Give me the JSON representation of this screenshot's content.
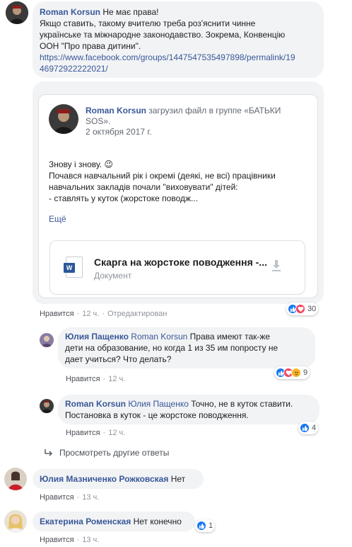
{
  "comment1": {
    "author": "Roman Korsun",
    "text_lines": [
      "Не має права!",
      "Якщо ставить, такому вчителю треба роз'яснити чинне",
      "українське та міжнародне законодавство. Зокрема, Конвенцію",
      "ООН \"Про права дитини\"."
    ],
    "link_lines": [
      "https://www.facebook.com/groups/1447547535497898/permalink/19",
      "46972922222021/"
    ],
    "shared": {
      "author": "Roman Korsun",
      "action": "загрузил файл в группе «БАТЬКИ",
      "group_cont": "SOS».",
      "date": "2 октября 2017 г.",
      "body_lines": [
        "Знову і знову. 😉",
        "Почався навчальний рік і окремі (деякі, не всі) працівники",
        "навчальних закладів почали \"виховувати\" дітей:",
        "- ставлять у куток (жорстоке поводж..."
      ],
      "more": "Ещё",
      "file_title": "Скарга на жорстоке поводження -...",
      "file_type": "Документ",
      "file_icon_letter": "W"
    },
    "actions": {
      "like": "Нравится",
      "time": "12 ч.",
      "edited": "Отредактирован"
    },
    "reactions_count": "30"
  },
  "reply1": {
    "author": "Юлия Пащенко",
    "mention": "Roman Korsun",
    "text_lines": [
      "Права имеют так-же",
      "дети на образование, но когда 1 из 35 им попросту не",
      "дает учиться? Что делать?"
    ],
    "actions": {
      "like": "Нравится",
      "time": "12 ч."
    },
    "reactions_count": "9"
  },
  "reply2": {
    "author": "Roman Korsun",
    "mention": "Юлия Пащенко",
    "text_lines": [
      "Точно, не в куток ставити.",
      "Постановка в куток - це жорстоке поводження."
    ],
    "actions": {
      "like": "Нравится",
      "time": "12 ч."
    },
    "reactions_count": "4"
  },
  "more_replies": "Просмотреть другие ответы",
  "comment2": {
    "author": "Юлия Мазниченко Рожковская",
    "text": "Нет",
    "actions": {
      "like": "Нравится",
      "time": "13 ч."
    }
  },
  "comment3": {
    "author": "Екатерина Роменская",
    "text": "Нет конечно",
    "actions": {
      "like": "Нравится",
      "time": "13 ч."
    },
    "reactions_count": "1"
  },
  "colors": {
    "link": "#385898",
    "like_blue": "#1877f2",
    "love_red": "#f33e58",
    "haha_yellow": "#f7b125",
    "bubble": "#f2f3f5"
  }
}
